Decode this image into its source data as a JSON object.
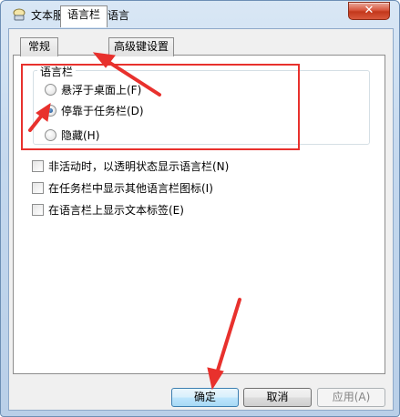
{
  "window": {
    "title": "文本服务和输入语言",
    "close_glyph": "✕"
  },
  "tabs": [
    {
      "label": "常规"
    },
    {
      "label": "语言栏"
    },
    {
      "label": "高级键设置"
    }
  ],
  "language_bar_group": {
    "legend": "语言栏",
    "options": [
      {
        "label": "悬浮于桌面上(F)",
        "checked": false
      },
      {
        "label": "停靠于任务栏(D)",
        "checked": true
      },
      {
        "label": "隐藏(H)",
        "checked": false
      }
    ]
  },
  "checkboxes": [
    {
      "label": "非活动时，以透明状态显示语言栏(N)",
      "checked": false
    },
    {
      "label": "在任务栏中显示其他语言栏图标(I)",
      "checked": false
    },
    {
      "label": "在语言栏上显示文本标签(E)",
      "checked": false
    }
  ],
  "buttons": {
    "ok": "确定",
    "cancel": "取消",
    "apply": "应用(A)"
  },
  "colors": {
    "annotation": "#e8312d",
    "accent": "#3c7fb1"
  }
}
